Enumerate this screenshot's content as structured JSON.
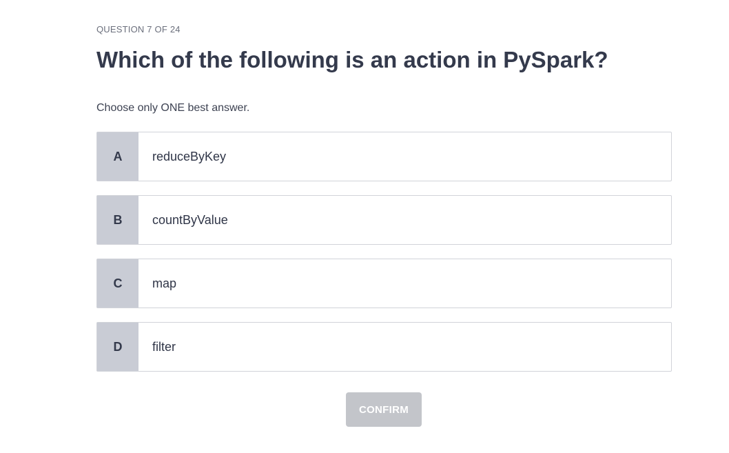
{
  "quiz": {
    "progress": "QUESTION 7 OF 24",
    "question": "Which of the following is an action in PySpark?",
    "instruction": "Choose only ONE best answer.",
    "options": [
      {
        "letter": "A",
        "text": "reduceByKey"
      },
      {
        "letter": "B",
        "text": "countByValue"
      },
      {
        "letter": "C",
        "text": "map"
      },
      {
        "letter": "D",
        "text": "filter"
      }
    ],
    "confirm_label": "CONFIRM"
  },
  "colors": {
    "letter_bg": "#c9ccd5",
    "option_border": "#d1d3d9",
    "confirm_disabled_bg": "#c3c5ca",
    "heading_text": "#343a4c"
  }
}
